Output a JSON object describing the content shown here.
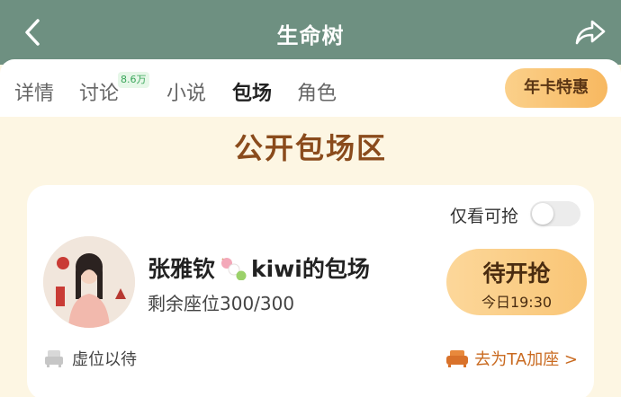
{
  "header": {
    "title": "生命树",
    "back_icon": "chevron-left-icon",
    "share_icon": "share-arrow-icon",
    "bg_color": "#6e9081"
  },
  "tabs": [
    {
      "label": "详情",
      "active": false
    },
    {
      "label": "讨论",
      "active": false,
      "badge": "8.6万"
    },
    {
      "label": "小说",
      "active": false
    },
    {
      "label": "包场",
      "active": true
    },
    {
      "label": "角色",
      "active": false
    }
  ],
  "annual_card_button": "年卡特惠",
  "section_title": "公开包场区",
  "card": {
    "filter_label": "仅看可抢",
    "filter_on": false,
    "host_name": "张雅钦",
    "room_suffix": "kiwi的包场",
    "seats_text": "剩余座位300/300",
    "grab_button": {
      "label": "待开抢",
      "time": "今日19:30"
    },
    "virtual_seat_label": "虚位以待",
    "goto_seat_label": "去为TA加座 >",
    "accent_color": "#c96a20"
  }
}
